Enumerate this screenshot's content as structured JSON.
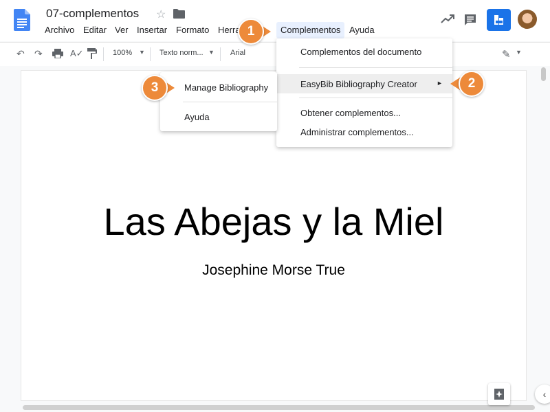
{
  "header": {
    "title": "07-complementos",
    "star_icon": "star-icon",
    "folder_icon": "folder-icon",
    "menu": [
      "Archivo",
      "Editar",
      "Ver",
      "Insertar",
      "Formato",
      "Herra",
      "Complementos",
      "Ayuda"
    ],
    "right_icons": [
      "activity-icon",
      "comment-icon",
      "share-icon",
      "avatar"
    ]
  },
  "toolbar": {
    "zoom": "100%",
    "style": "Texto norm...",
    "font": "Arial",
    "icons": [
      "undo-icon",
      "redo-icon",
      "print-icon",
      "spellcheck-icon",
      "paint-format-icon",
      "pencil-icon"
    ]
  },
  "complementos_menu": {
    "items": [
      "Complementos del documento",
      "EasyBib Bibliography Creator",
      "Obtener complementos...",
      "Administrar complementos..."
    ],
    "submenu_arrow": "►"
  },
  "easybib_submenu": {
    "items": [
      "Manage Bibliography",
      "Ayuda"
    ]
  },
  "document": {
    "heading": "Las Abejas y la Miel",
    "author": "Josephine Morse True"
  },
  "callouts": [
    "1",
    "2",
    "3"
  ],
  "colors": {
    "callout": "#ed8a3a",
    "accent": "#1a73e8",
    "menu_highlight": "#e8f0fe"
  }
}
